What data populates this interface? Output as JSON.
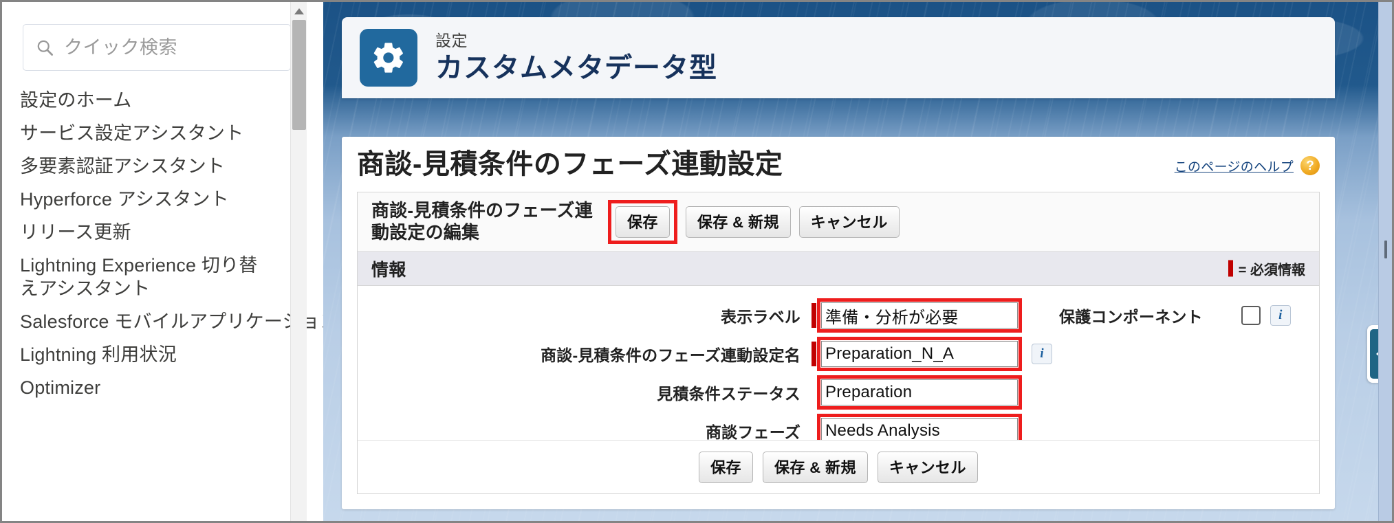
{
  "sidebar": {
    "search": {
      "placeholder": "クイック検索",
      "value": "",
      "icon": "search-icon"
    },
    "items": [
      {
        "label": "設定のホーム",
        "wrap": false
      },
      {
        "label": "サービス設定アシスタント",
        "wrap": false
      },
      {
        "label": "多要素認証アシスタント",
        "wrap": false
      },
      {
        "label": "Hyperforce アシスタント",
        "wrap": false
      },
      {
        "label": "リリース更新",
        "wrap": false
      },
      {
        "label": "Lightning Experience 切り替えアシスタント",
        "wrap": true
      },
      {
        "label": "Salesforce モバイルアプリケーション",
        "wrap": false
      },
      {
        "label": "Lightning 利用状況",
        "wrap": false
      },
      {
        "label": "Optimizer",
        "wrap": false
      }
    ]
  },
  "header": {
    "icon": "gear-icon",
    "eyebrow": "設定",
    "title": "カスタムメタデータ型"
  },
  "page": {
    "title": "商談-見積条件のフェーズ連動設定",
    "help_label": "このページのヘルプ",
    "help_icon": "?"
  },
  "form": {
    "head_title": "商談-見積条件のフェーズ連動設定の編集",
    "buttons": {
      "save": "保存",
      "save_new": "保存 & 新規",
      "cancel": "キャンセル"
    },
    "section_title": "情報",
    "required_legend": "= 必須情報",
    "fields": [
      {
        "label": "表示ラベル",
        "value": "準備・分析が必要",
        "required": true,
        "highlighted": true,
        "info": false
      },
      {
        "label": "商談-見積条件のフェーズ連動設定名",
        "value": "Preparation_N_A",
        "required": true,
        "highlighted": true,
        "info": true
      },
      {
        "label": "見積条件ステータス",
        "value": "Preparation",
        "required": false,
        "highlighted": true,
        "info": false
      },
      {
        "label": "商談フェーズ",
        "value": "Needs Analysis",
        "required": false,
        "highlighted": true,
        "info": false
      }
    ],
    "protected": {
      "label": "保護コンポーネント",
      "checked": false,
      "info": true
    }
  },
  "colors": {
    "highlight": "#ee1d1d",
    "required": "#c00000",
    "brand_blue": "#21699e",
    "title_navy": "#16325c",
    "collapse_tab": "#1f6585",
    "help_orange": "#f0a921"
  }
}
